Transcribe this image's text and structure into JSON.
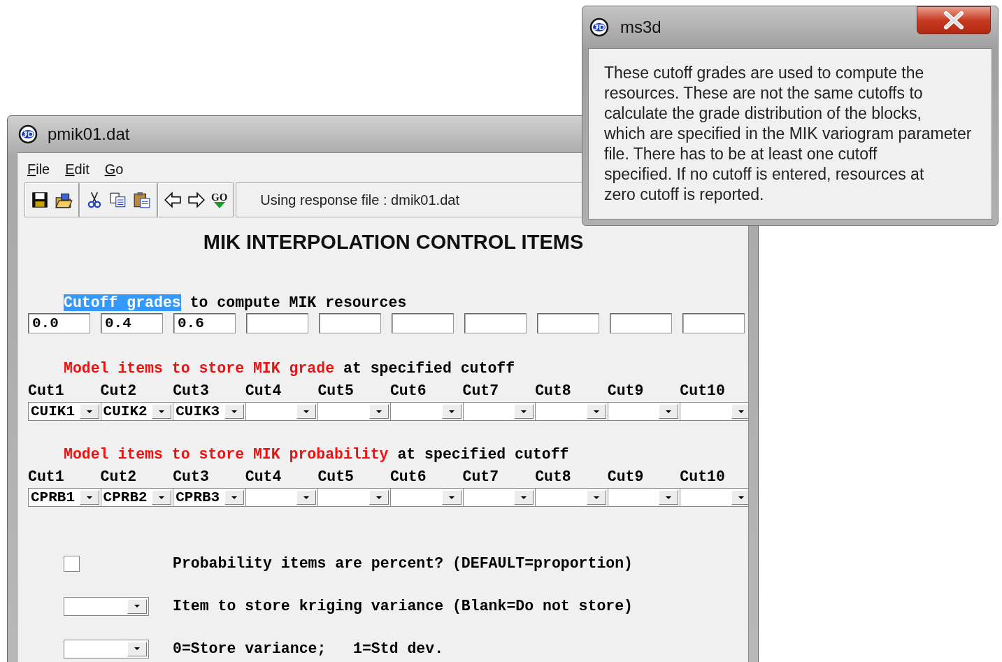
{
  "main_window": {
    "title": "pmik01.dat",
    "menu": [
      {
        "label": "File"
      },
      {
        "label": "Edit"
      },
      {
        "label": "Go"
      }
    ],
    "toolbar": {
      "groups": [
        [
          {
            "kind": "save"
          },
          {
            "kind": "open"
          }
        ],
        [
          {
            "kind": "cut"
          },
          {
            "kind": "copy"
          },
          {
            "kind": "paste"
          }
        ],
        [
          {
            "kind": "back"
          },
          {
            "kind": "forward"
          },
          {
            "kind": "go"
          }
        ]
      ],
      "go_label": "GO",
      "status": "Using response file : dmik01.dat"
    },
    "heading": "MIK INTERPOLATION CONTROL ITEMS",
    "cutoff_section": {
      "caption": [
        {
          "text": "Cutoff grades",
          "highlighted": true
        },
        {
          "text": " to compute MIK resources",
          "highlighted": false
        }
      ],
      "fields": [
        {
          "kind": "filled",
          "value": "0.0"
        },
        {
          "kind": "filled",
          "value": "0.4"
        },
        {
          "kind": "filled",
          "value": "0.6"
        },
        {
          "kind": "blank"
        },
        {
          "kind": "blank"
        },
        {
          "kind": "blank"
        },
        {
          "kind": "blank"
        },
        {
          "kind": "blank"
        },
        {
          "kind": "blank"
        },
        {
          "kind": "blank"
        }
      ]
    },
    "grade_section": {
      "caption": [
        {
          "text": "Model items to store MIK grade",
          "emphasis": true
        },
        {
          "text": " at specified cutoff",
          "emphasis": false
        }
      ],
      "dropdowns": [
        {
          "label": "Cut1",
          "value": "CUIK1"
        },
        {
          "label": "Cut2",
          "value": "CUIK2"
        },
        {
          "label": "Cut3",
          "value": "CUIK3"
        },
        {
          "label": "Cut4"
        },
        {
          "label": "Cut5"
        },
        {
          "label": "Cut6"
        },
        {
          "label": "Cut7"
        },
        {
          "label": "Cut8"
        },
        {
          "label": "Cut9"
        },
        {
          "label": "Cut10"
        }
      ]
    },
    "probability_section": {
      "caption": [
        {
          "text": "Model items to store MIK probability",
          "emphasis": true
        },
        {
          "text": " at specified cutoff",
          "emphasis": false
        }
      ],
      "dropdowns": [
        {
          "label": "Cut1",
          "value": "CPRB1"
        },
        {
          "label": "Cut2",
          "value": "CPRB2"
        },
        {
          "label": "Cut3",
          "value": "CPRB3"
        },
        {
          "label": "Cut4"
        },
        {
          "label": "Cut5"
        },
        {
          "label": "Cut6"
        },
        {
          "label": "Cut7"
        },
        {
          "label": "Cut8"
        },
        {
          "label": "Cut9"
        },
        {
          "label": "Cut10"
        }
      ]
    },
    "options": [
      {
        "kind": "checkbox",
        "checked": false,
        "label": "Probability items are percent? (DEFAULT=proportion)"
      },
      {
        "kind": "dropdown",
        "label": "Item to store kriging variance (Blank=Do not store)"
      },
      {
        "kind": "dropdown",
        "label": "0=Store variance;   1=Std dev."
      }
    ]
  },
  "help_popup": {
    "title": "ms3d",
    "text_lines": [
      "These cutoff grades are used to compute the",
      "resources. These are not the same cutoffs to",
      "calculate the grade distribution of the blocks,",
      "which are specified in the MIK variogram parameter",
      "file. There has to be at least one cutoff",
      "specified. If no cutoff is entered, resources at",
      "zero cutoff is reported."
    ]
  }
}
